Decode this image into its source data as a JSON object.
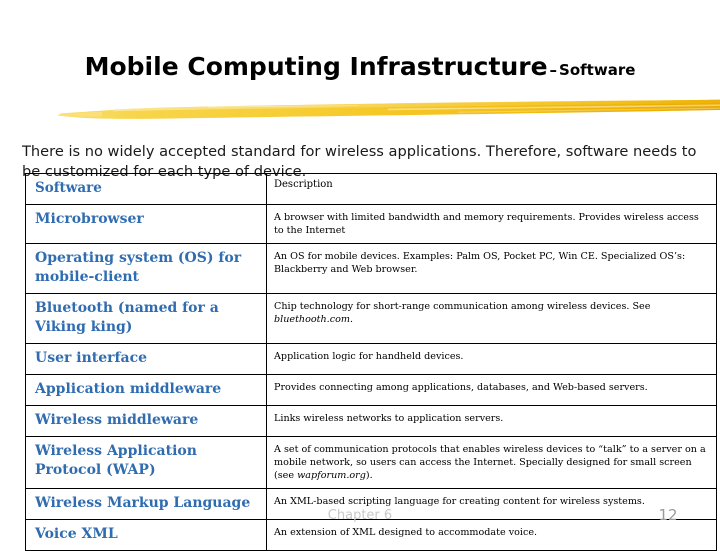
{
  "slide": {
    "title_main": "Mobile Computing Infrastructure",
    "title_dash": "–",
    "title_sub": "Software",
    "intro": "There is no widely accepted standard for wireless applications. Therefore, software needs to be customized for each type of device.",
    "footer_chapter": "Chapter 6",
    "page_number": "12"
  },
  "colors": {
    "heading_text": "#000000",
    "table_term": "#2f6cb0",
    "table_border": "#000000",
    "brush_light": "#f7d54a",
    "brush_mid": "#f5c623",
    "brush_dark": "#e9a800",
    "footer_gray": "#9a9a9a",
    "watermark_gray": "#c9c9c9",
    "background": "#ffffff"
  },
  "table": {
    "headers": {
      "name": "Software",
      "description": "Description"
    },
    "rows": [
      {
        "name": "Microbrowser",
        "description": "A browser with limited bandwidth and memory requirements.  Provides wireless access to the Internet"
      },
      {
        "name": "Operating system (OS) for mobile-client",
        "description": "An OS for mobile devices.  Examples: Palm OS, Pocket PC, Win CE.  Specialized OS’s: Blackberry and Web browser."
      },
      {
        "name": "Bluetooth (named for a Viking king)",
        "description_pre": "Chip technology for short-range communication among wireless devices. See ",
        "description_italic": "bluethooth.com",
        "description_post": "."
      },
      {
        "name": "User interface",
        "description": "Application logic for handheld devices."
      },
      {
        "name": "Application middleware",
        "description": "Provides connecting among applications, databases, and Web-based servers."
      },
      {
        "name": "Wireless middleware",
        "description": "Links wireless networks to application servers."
      },
      {
        "name": "Wireless Application Protocol (WAP)",
        "description_pre": "A set of communication protocols that enables wireless devices to “talk” to a server on a mobile network, so users can access the Internet.  Specially designed for small screen (see ",
        "description_italic": "wapforum.org",
        "description_post": ")."
      },
      {
        "name": "Wireless Markup Language",
        "description": "An XML-based scripting language for creating content for wireless systems."
      },
      {
        "name": "Voice XML",
        "description": "An extension of XML designed to accommodate voice."
      }
    ]
  }
}
